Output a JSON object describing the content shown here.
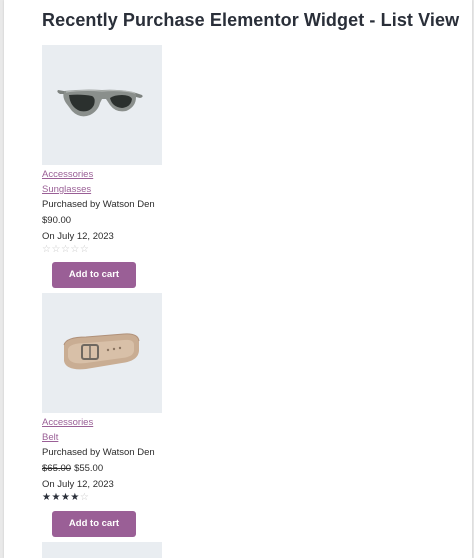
{
  "page": {
    "title": "Recently Purchase Elementor Widget - List View"
  },
  "products": [
    {
      "category": "Accessories",
      "name": "Sunglasses",
      "purchased_by": "Purchased by Watson Den",
      "price": "$90.00",
      "date": "On July 12, 2023",
      "rating": 0,
      "rating_max": 5,
      "button_label": "Add to cart",
      "image_icon": "sunglasses-icon"
    },
    {
      "category": "Accessories",
      "name": "Belt",
      "purchased_by": "Purchased by Watson Den",
      "old_price": "$65.00",
      "price": "$55.00",
      "date": "On July 12, 2023",
      "rating": 4,
      "rating_max": 5,
      "button_label": "Add to cart",
      "image_icon": "belt-icon"
    }
  ],
  "colors": {
    "accent": "#9a5f96",
    "title": "#2a2f39",
    "thumb_bg": "#e9edf1"
  }
}
